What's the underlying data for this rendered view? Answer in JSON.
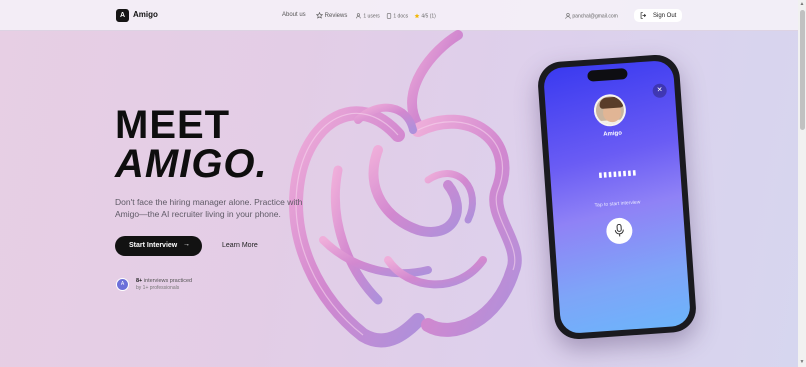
{
  "app": {
    "logo_letter": "A",
    "name": "Amigo"
  },
  "nav": {
    "about": "About us",
    "reviews": "Reviews",
    "users": "1 users",
    "docs": "1 docs",
    "rating": "4/5 (1)",
    "email": "panchal@gmail.com",
    "signout": "Sign Out"
  },
  "hero": {
    "title_line1": "MEET",
    "title_line2": "AMIGO.",
    "subtitle": "Don't face the hiring manager alone. Practice with Amigo—the AI recruiter living in your phone.",
    "start_button": "Start Interview",
    "learn_more": "Learn More",
    "avatar_letter": "A",
    "stat_count": "8+",
    "stat_text": " interviews practiced",
    "stat_sub": "by 1+ professionals"
  },
  "phone": {
    "close_icon": "close-icon",
    "name": "Amigo",
    "dots": "▮▮▮▮▮▮▮▮",
    "tap_text": "Tap to start interview",
    "mic_icon": "mic-icon"
  },
  "colors": {
    "accent": "#121212",
    "phone_gradient_top": "#3a3af0",
    "phone_gradient_bottom": "#6cb4fb",
    "star": "#f2b705"
  }
}
